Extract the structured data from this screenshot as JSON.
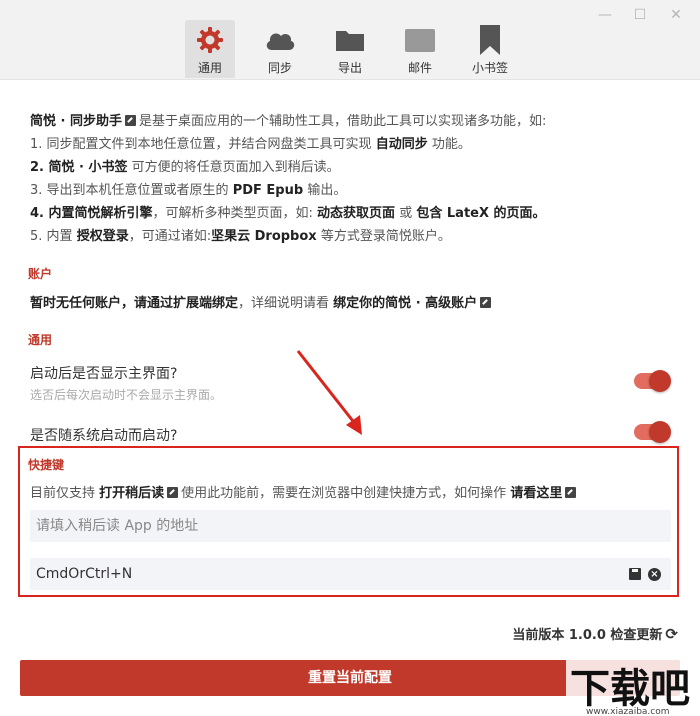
{
  "window": {
    "minimize": "—",
    "maximize": "☐",
    "close": "✕"
  },
  "tabs": [
    {
      "label": "通用",
      "icon": "gear-icon",
      "active": true
    },
    {
      "label": "同步",
      "icon": "cloud-icon"
    },
    {
      "label": "导出",
      "icon": "folder-icon"
    },
    {
      "label": "邮件",
      "icon": "mail-icon"
    },
    {
      "label": "小书签",
      "icon": "bookmark-icon"
    }
  ],
  "intro": {
    "l1_b": "简悦 · 同步助手",
    "l1_t": "是基于桌面应用的一个辅助性工具，借助此工具可以实现诸多功能，如:",
    "l2_t1": "1. 同步配置文件到本地任意位置，并结合网盘类工具可实现",
    "l2_b": "自动同步",
    "l2_t2": "功能。",
    "l3_b": "2. 简悦 · 小书签",
    "l3_t": "可方便的将任意页面加入到稍后读。",
    "l4_t1": "3. 导出到本机任意位置或者原生的",
    "l4_b": "PDF Epub",
    "l4_t2": "输出。",
    "l5_b1": "4. 内置简悦解析引擎",
    "l5_t1": "，可解析多种类型页面，如:",
    "l5_b2": "动态获取页面",
    "l5_t2": "或",
    "l5_b3": "包含 LateX 的页面。",
    "l6_t1": "5. 内置",
    "l6_b1": "授权登录",
    "l6_t2": "，可通过诸如:",
    "l6_b2": "坚果云 Dropbox",
    "l6_t3": "等方式登录简悦账户。"
  },
  "account": {
    "title": "账户",
    "text_b": "暂时无任何账户，请通过扩展端绑定",
    "text_t": "，详细说明请看",
    "link": "绑定你的简悦 · 高级账户"
  },
  "general": {
    "title": "通用",
    "opt1_label": "启动后是否显示主界面?",
    "opt1_desc": "选否后每次启动时不会显示主界面。",
    "opt2_label": "是否随系统启动而启动?"
  },
  "shortcut": {
    "title": "快捷键",
    "desc_t1": "目前仅支持",
    "desc_b": "打开稍后读",
    "desc_t2": "使用此功能前，需要在浏览器中创建快捷方式，如何操作",
    "desc_link": "请看这里",
    "placeholder": "请填入稍后读 App 的地址",
    "hotkey_value": "CmdOrCtrl+N"
  },
  "footer": {
    "version": "当前版本 1.0.0 检查更新",
    "reset_label": "重置当前配置"
  },
  "watermark": {
    "big": "下载吧",
    "small": "www.xiazaiba.com"
  },
  "colors": {
    "accent": "#c0392b",
    "highlight": "#d8261e"
  }
}
